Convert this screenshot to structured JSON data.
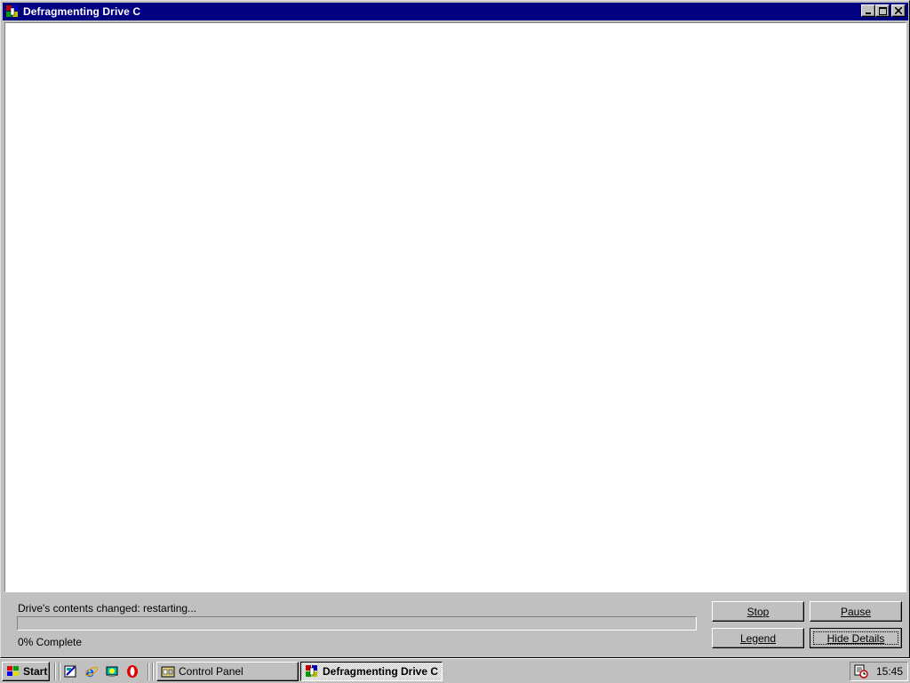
{
  "window": {
    "title": "Defragmenting Drive C",
    "status": "Drive's contents changed: restarting...",
    "progress_percent": 0,
    "complete_label": "0% Complete",
    "buttons": {
      "stop": "Stop",
      "pause": "Pause",
      "legend": "Legend",
      "hide_details": "Hide Details"
    }
  },
  "taskbar": {
    "start_label": "Start",
    "quick_launch": [
      "show-desktop-icon",
      "internet-explorer-icon",
      "channels-icon",
      "opera-icon"
    ],
    "tasks": [
      {
        "label": "Control Panel",
        "active": false
      },
      {
        "label": "Defragmenting Drive C",
        "active": true
      }
    ],
    "clock": "15:45"
  },
  "colors": {
    "titlebar": "#000080",
    "face": "#c0c0c0",
    "client": "#ffffff"
  }
}
